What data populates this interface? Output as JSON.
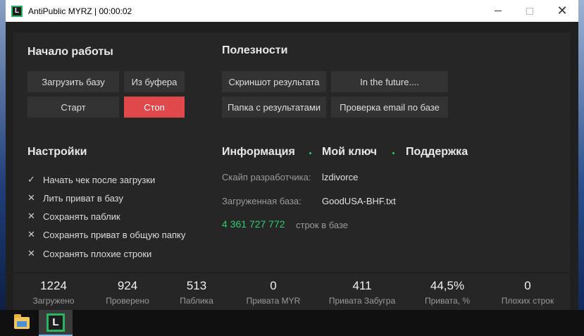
{
  "window": {
    "title": "AntiPublic MYRZ | 00:00:02",
    "app_icon_letter": "L"
  },
  "start_section": {
    "heading": "Начало работы",
    "load_base": "Загрузить базу",
    "from_clipboard": "Из буфера",
    "start": "Старт",
    "stop": "Стоп"
  },
  "utilities": {
    "heading": "Полезности",
    "screenshot": "Скриншот результата",
    "future": "In the future....",
    "results_folder": "Папка с результатами",
    "email_check": "Проверка email по базе"
  },
  "settings": {
    "heading": "Настройки",
    "items": [
      {
        "mark": "✓",
        "label": "Начать чек после загрузки"
      },
      {
        "mark": "✕",
        "label": "Лить приват в базу"
      },
      {
        "mark": "✕",
        "label": "Сохранять паблик"
      },
      {
        "mark": "✕",
        "label": "Сохранять приват в общую папку"
      },
      {
        "mark": "✕",
        "label": "Сохранять плохие строки"
      }
    ]
  },
  "info": {
    "tab_info": "Информация",
    "tab_key": "Мой ключ",
    "tab_support": "Поддержка",
    "dev_skype_label": "Скайп разработчика:",
    "dev_skype_value": "lzdivorce",
    "loaded_base_label": "Загруженная база:",
    "loaded_base_value": "GoodUSA-BHF.txt",
    "rows_count": "4 361 727 772",
    "rows_label": "строк в базе"
  },
  "stats": [
    {
      "value": "1224",
      "label": "Загружено"
    },
    {
      "value": "924",
      "label": "Проверено"
    },
    {
      "value": "513",
      "label": "Паблика"
    },
    {
      "value": "0",
      "label": "Привата MYR"
    },
    {
      "value": "411",
      "label": "Привата Забугра"
    },
    {
      "value": "44,5%",
      "label": "Привата, %"
    },
    {
      "value": "0",
      "label": "Плохих строк"
    }
  ],
  "taskbar": {
    "app_letter": "L"
  },
  "colors": {
    "accent_green": "#2ecc71",
    "stop_red": "#e0484b",
    "panel": "#262626"
  }
}
